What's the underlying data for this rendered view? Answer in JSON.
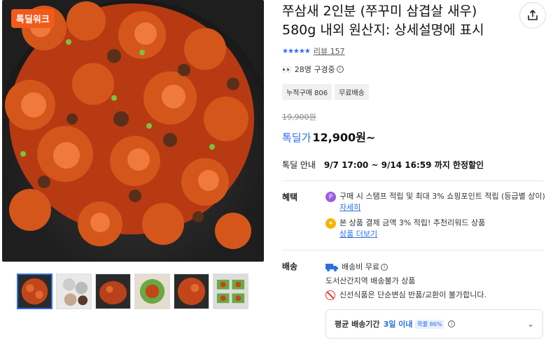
{
  "gallery": {
    "badge": "톡딜워크",
    "thumb_count": 6
  },
  "product": {
    "title": "쭈삼새 2인분 (쭈꾸미 삼겹살 새우) 580g 내외 원산지: 상세설명에 표시",
    "stars": "★★★★★",
    "review_text": "리뷰 157",
    "watchers_text": "28명 구경중",
    "tags": [
      "누적구매 806",
      "무료배송"
    ],
    "original_price": "19,900원",
    "price_label": "톡딜가",
    "price": "12,900원~",
    "deal_label": "톡딜 안내",
    "deal_period": "9/7 17:00 ~ 9/14 16:59 까지 한정할인"
  },
  "benefit": {
    "label": "혜택",
    "line1": "구매 시 스탬프 적립 및 최대 3% 쇼핑포인트 적립 (등급별 상이)",
    "line1_link": "자세히",
    "line2": "본 상품 결제 금액 3% 적립! 추천리워드 상품",
    "line2_link": "상품 더보기"
  },
  "shipping": {
    "label": "배송",
    "fee": "배송비 무료",
    "note": "도서산간지역 배송불가 상품",
    "fresh": "신선식품은 단순변심 반품/교환이 불가합니다.",
    "avg_label": "평균 배송기간",
    "avg_days": "3일 이내",
    "probability": "확률 86%"
  },
  "colors": {
    "accent": "#2b6ee8",
    "badge": "#f25a1a"
  }
}
